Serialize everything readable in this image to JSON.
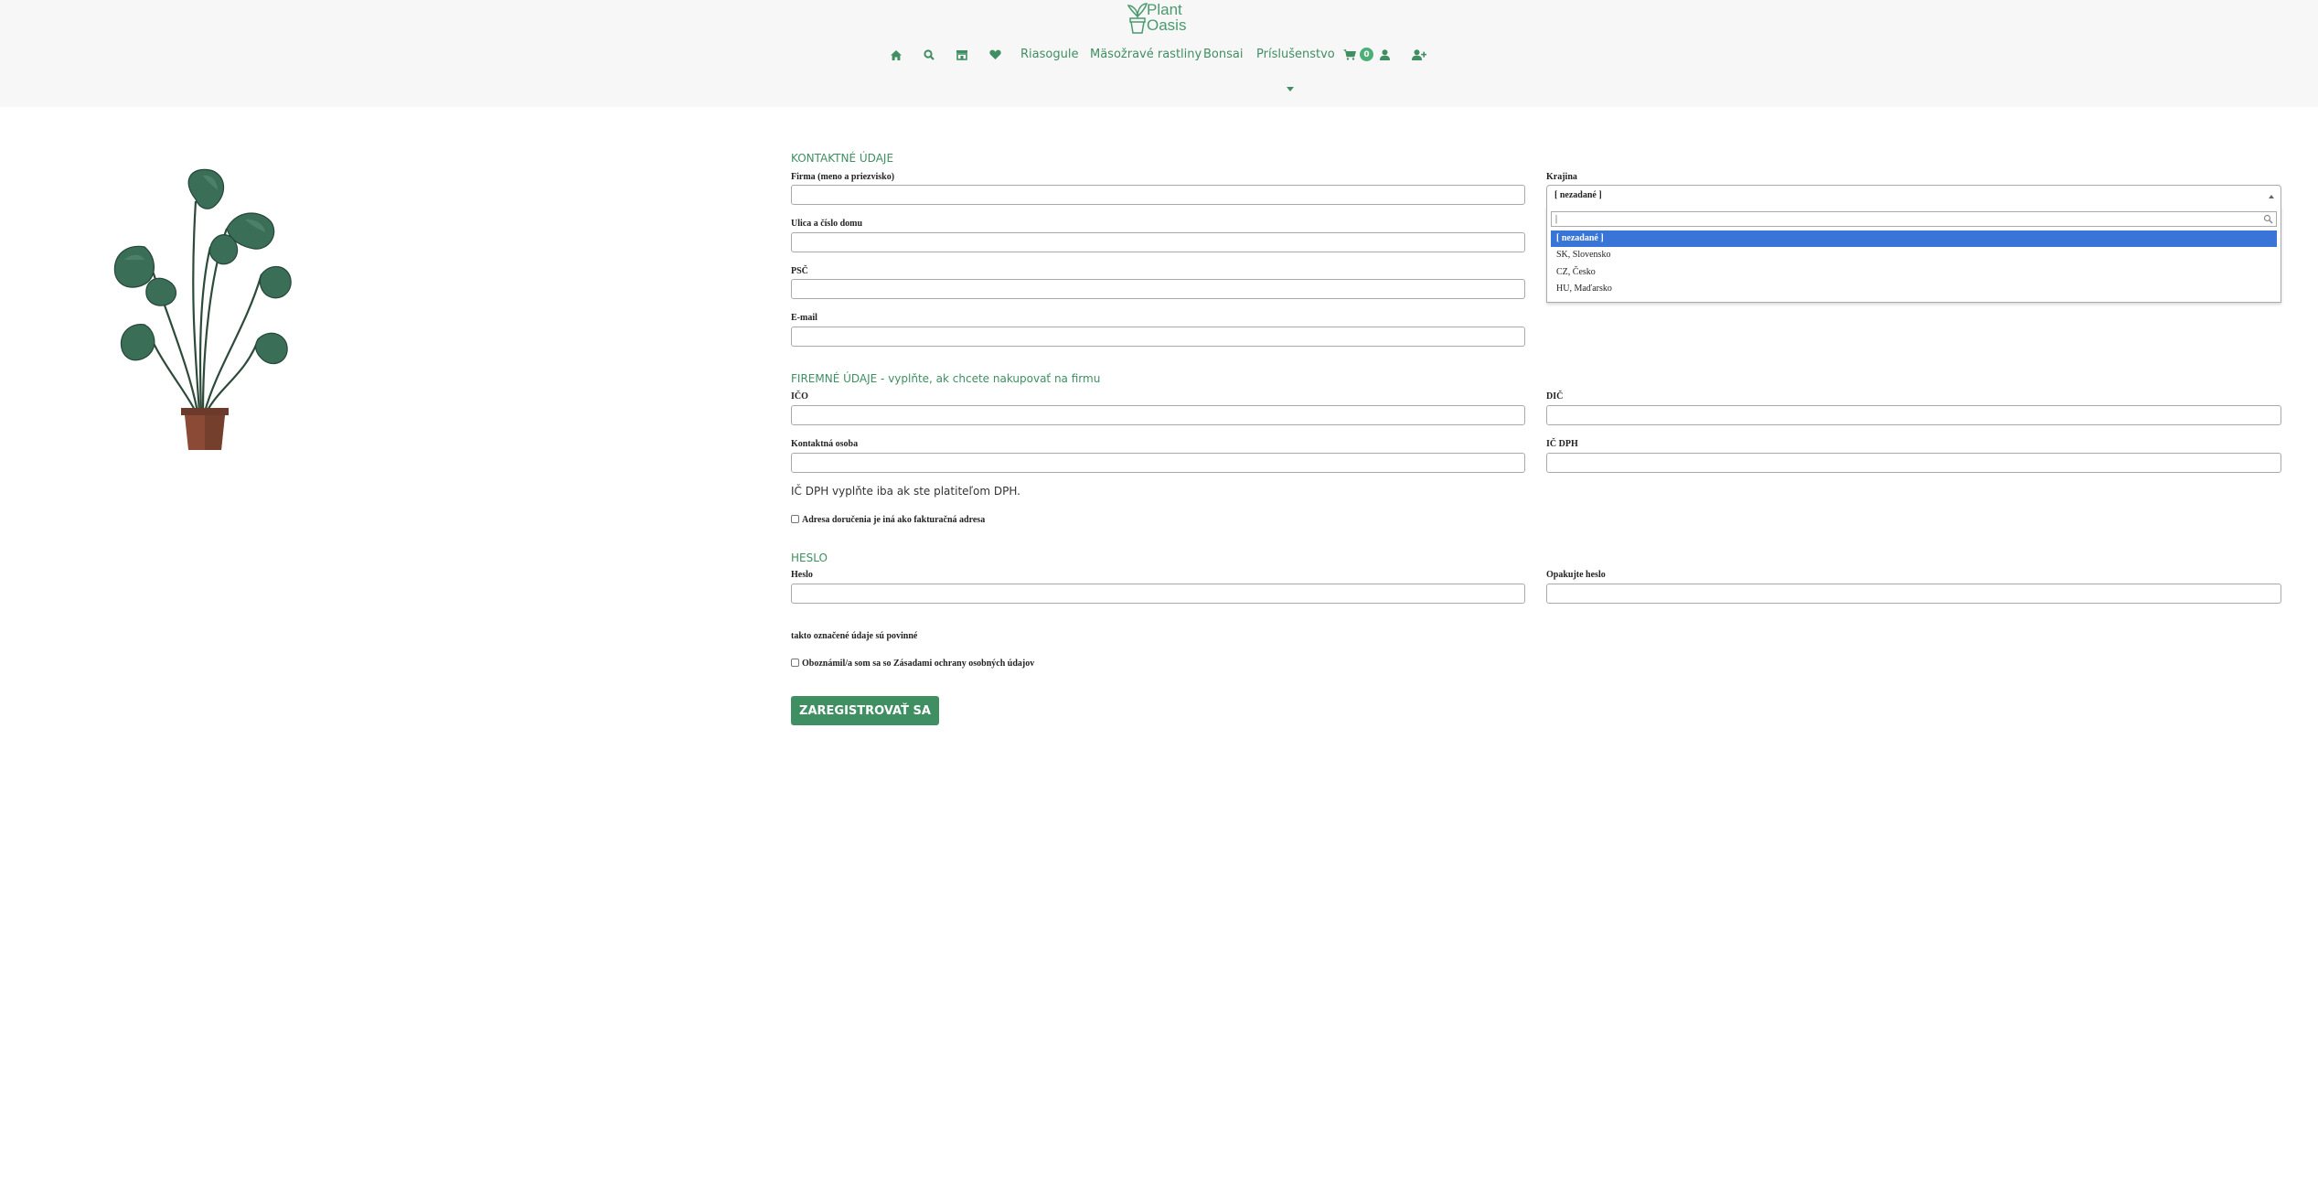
{
  "brand": {
    "logo_text_line1": "Plant",
    "logo_text_line2": "Oasis",
    "accent_color": "#3f8f62"
  },
  "nav": {
    "icons": [
      "home-icon",
      "search-icon",
      "store-icon",
      "heart-icon"
    ],
    "links": [
      "Riasogule",
      "Mäsožravé rastliny",
      "Bonsai",
      "Príslušenstvo"
    ],
    "cart_count": "0"
  },
  "contact": {
    "title": "KONTAKTNÉ ÚDAJE",
    "company_label": "Firma (meno a priezvisko)",
    "street_label": "Ulica a číslo domu",
    "zip_label": "PSČ",
    "email_label": "E-mail",
    "country_label": "Krajina",
    "country_selected": "[ nezadané ]",
    "country_search_value": "|",
    "country_options": [
      "[ nezadané ]",
      "SK, Slovensko",
      "CZ, Česko",
      "HU, Maďarsko"
    ]
  },
  "company": {
    "title": "FIREMNÉ ÚDAJE - vyplňte, ak chcete nakupovať na firmu",
    "ico_label": "IČO",
    "dic_label": "DIČ",
    "contact_person_label": "Kontaktná osoba",
    "icdph_label": "IČ DPH",
    "icdph_note": "IČ DPH vyplňte iba ak ste platiteľom DPH.",
    "delivery_checkbox_label": "Adresa doručenia je iná ako fakturačná adresa"
  },
  "password": {
    "title": "HESLO",
    "password_label": "Heslo",
    "repeat_label": "Opakujte heslo"
  },
  "footer": {
    "required_note": "takto označené údaje sú povinné",
    "consent_prefix": "Oboznámil/a som sa so ",
    "consent_link": "Zásadami ochrany osobných údajov",
    "submit_label": "ZAREGISTROVAŤ SA"
  }
}
